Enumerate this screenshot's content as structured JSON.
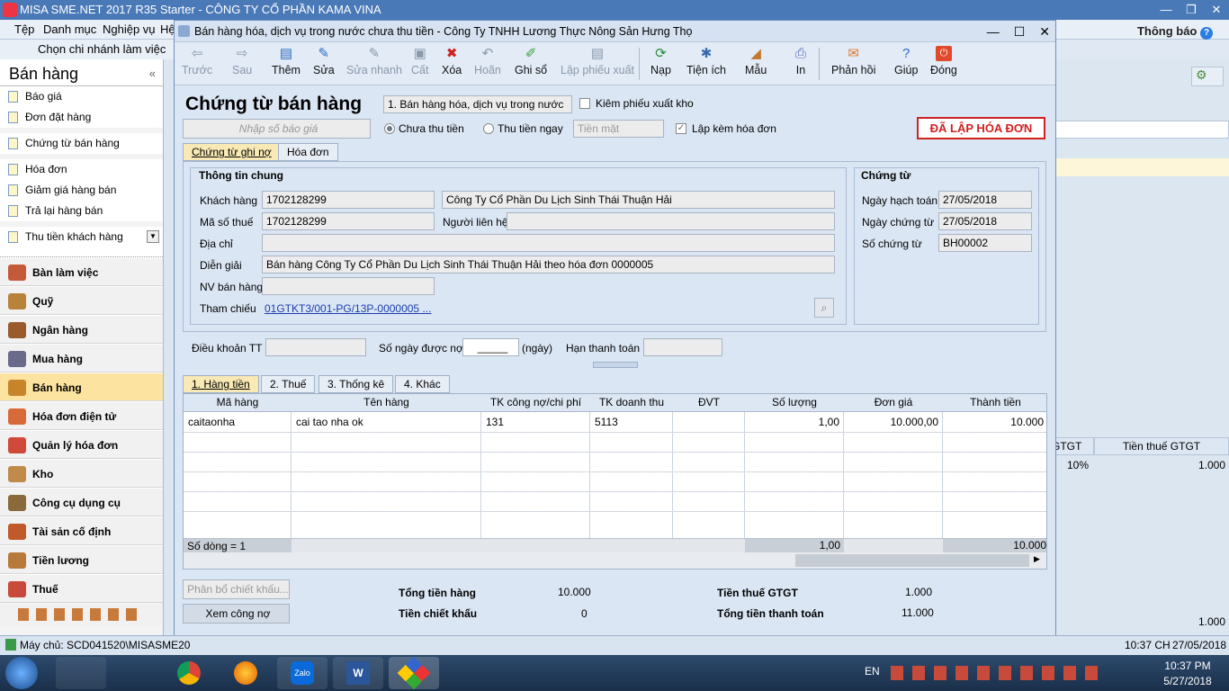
{
  "app": {
    "title": "MISA SME.NET 2017 R35 Starter - CÔNG TY CỔ PHẦN KAMA VINA",
    "notify": "Thông báo"
  },
  "menu": [
    "Tệp",
    "Danh mục",
    "Nghiệp vụ",
    "Hệ"
  ],
  "branch": "Chọn chi nhánh làm việc",
  "sidebar": {
    "title": "Bán hàng",
    "subs": [
      "Báo giá",
      "Đơn đặt hàng",
      "Chứng từ bán hàng",
      "Hóa đơn",
      "Giảm giá hàng bán",
      "Trả lại hàng bán",
      "Thu tiền khách hàng"
    ],
    "modules": [
      "Bàn làm việc",
      "Quỹ",
      "Ngân hàng",
      "Mua hàng",
      "Bán hàng",
      "Hóa đơn điện tử",
      "Quản lý hóa đơn",
      "Kho",
      "Công cụ dụng cụ",
      "Tài sản cố định",
      "Tiền lương",
      "Thuế"
    ]
  },
  "dialog": {
    "title": "Bán hàng hóa, dịch vụ trong nước chưa thu tiền - Công Ty TNHH Lương Thực Nông Sản Hưng Thọ"
  },
  "toolbar": {
    "prev": "Trước",
    "next": "Sau",
    "add": "Thêm",
    "edit": "Sửa",
    "quickedit": "Sửa nhanh",
    "save": "Cất",
    "delete": "Xóa",
    "undo": "Hoãn",
    "post": "Ghi sổ",
    "export_slip": "Lập phiếu xuất",
    "reload": "Nạp",
    "utility": "Tiện ích",
    "template": "Mẫu",
    "print": "In",
    "feedback": "Phản hồi",
    "help": "Giúp",
    "close": "Đóng"
  },
  "form": {
    "heading": "Chứng từ bán hàng",
    "type": "1. Bán hàng hóa, dịch vụ trong nước",
    "stock_check": "Kiêm phiếu xuất kho",
    "quote_placeholder": "Nhập số báo giá",
    "unpaid": "Chưa thu tiền",
    "paid_now": "Thu tiền ngay",
    "cash_placeholder": "Tiền mặt",
    "with_invoice": "Lập kèm hóa đơn",
    "invoice_badge": "ĐÃ LẬP HÓA ĐƠN",
    "tab_debt": "Chứng từ ghi nợ",
    "tab_invoice": "Hóa đơn",
    "general": {
      "title": "Thông tin chung",
      "customer_label": "Khách hàng",
      "customer_code": "1702128299",
      "customer_name": "Công Ty Cổ Phần Du Lịch Sinh Thái Thuận Hải",
      "taxcode_label": "Mã số thuế",
      "taxcode": "1702128299",
      "contact_label": "Người liên hệ",
      "contact": "",
      "address_label": "Địa chỉ",
      "address": "",
      "desc_label": "Diễn giải",
      "desc": "Bán hàng Công Ty Cổ Phần Du Lịch Sinh Thái Thuận Hải theo hóa đơn 0000005",
      "staff_label": "NV bán hàng",
      "staff": "",
      "ref_label": "Tham chiếu",
      "ref": "01GTKT3/001-PG/13P-0000005",
      "ref_more": "..."
    },
    "voucher": {
      "title": "Chứng từ",
      "posting_date_label": "Ngày hạch toán",
      "posting_date": "27/05/2018",
      "voucher_date_label": "Ngày chứng từ",
      "voucher_date": "27/05/2018",
      "voucher_no_label": "Số chứng từ",
      "voucher_no": "BH00002"
    },
    "terms_label": "Điều khoản TT",
    "days_label": "Số ngày được nợ",
    "days_unit": "(ngày)",
    "due_label": "Hạn thanh toán"
  },
  "grid": {
    "tabs": [
      "1. Hàng tiền",
      "2. Thuế",
      "3. Thống kê",
      "4. Khác"
    ],
    "columns": [
      "Mã hàng",
      "Tên hàng",
      "TK công nợ/chi phí",
      "TK doanh thu",
      "ĐVT",
      "Số lượng",
      "Đơn giá",
      "Thành tiền"
    ],
    "rows": [
      {
        "code": "caitaonha",
        "name": "cai tao nha ok",
        "debit": "131",
        "revenue": "5113",
        "unit": "",
        "qty": "1,00",
        "price": "10.000,00",
        "amount": "10.000"
      }
    ],
    "footer": {
      "count": "Số dòng = 1",
      "qty": "1,00",
      "amount": "10.000"
    }
  },
  "totals": {
    "discount_alloc": "Phân bổ chiết khấu...",
    "view_debt": "Xem công nợ",
    "goods_label": "Tổng tiền hàng",
    "goods": "10.000",
    "discount_label": "Tiền chiết khấu",
    "discount": "0",
    "vat_label": "Tiền thuế GTGT",
    "vat": "1.000",
    "total_label": "Tổng tiền thanh toán",
    "total": "11.000"
  },
  "background": {
    "col_gtgt": "GTGT",
    "col_vat": "Tiền thuế GTGT",
    "rate": "10%",
    "vat": "1.000",
    "total": "1.000"
  },
  "status": {
    "server": "Máy chủ: SCD041520\\MISASME20",
    "time": "10:37 CH",
    "date": "27/05/2018"
  },
  "taskbar": {
    "lang": "EN",
    "clock": "10:37 PM",
    "date": "5/27/2018"
  }
}
